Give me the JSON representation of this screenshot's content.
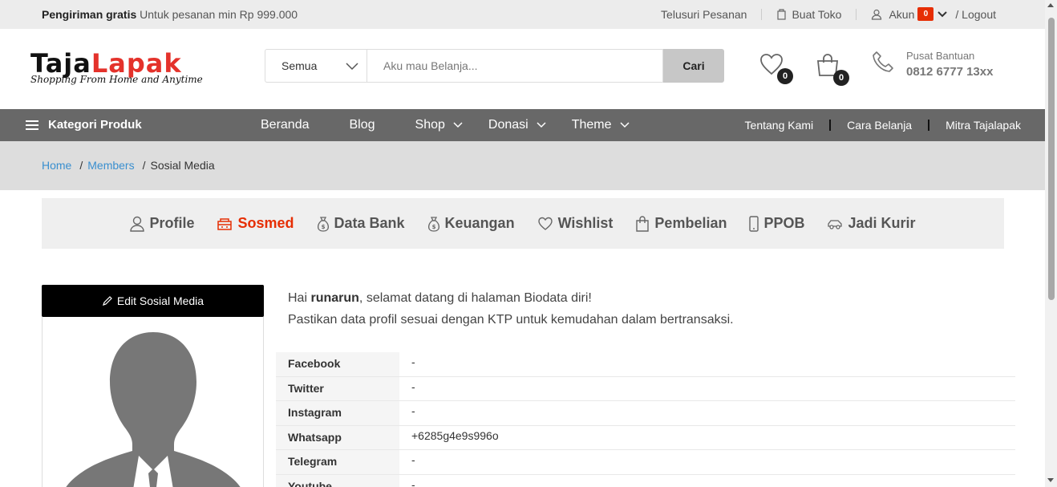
{
  "topbar": {
    "promo_bold": "Pengiriman gratis",
    "promo_text": "Untuk pesanan min Rp 999.000",
    "track_order": "Telusuri Pesanan",
    "open_store": "Buat Toko",
    "account": "Akun",
    "account_badge": "0",
    "logout": "/ Logout"
  },
  "header": {
    "logo_part1": "Taja",
    "logo_part2": "Lapak",
    "tagline": "Shopping From Home and Anytime",
    "search_category": "Semua",
    "search_placeholder": "Aku mau Belanja...",
    "search_button": "Cari",
    "wishlist_count": "0",
    "cart_count": "0",
    "help_label": "Pusat Bantuan",
    "help_phone": "0812 6777 13xx"
  },
  "nav": {
    "categories": "Kategori Produk",
    "items": [
      "Beranda",
      "Blog",
      "Shop",
      "Donasi",
      "Theme"
    ],
    "right_links": [
      "Tentang Kami",
      "Cara Belanja",
      "Mitra Tajalapak"
    ]
  },
  "breadcrumb": {
    "home": "Home",
    "members": "Members",
    "current": "Sosial Media"
  },
  "tabs": [
    {
      "label": "Profile",
      "icon": "user-icon"
    },
    {
      "label": "Sosmed",
      "icon": "sosmed-icon"
    },
    {
      "label": "Data Bank",
      "icon": "money-bag-icon"
    },
    {
      "label": "Keuangan",
      "icon": "money-bag-icon"
    },
    {
      "label": "Wishlist",
      "icon": "heart-icon"
    },
    {
      "label": "Pembelian",
      "icon": "shopping-bag-icon"
    },
    {
      "label": "PPOB",
      "icon": "phone-icon"
    },
    {
      "label": "Jadi Kurir",
      "icon": "car-icon"
    }
  ],
  "sidebar": {
    "edit_button": "Edit Sosial Media"
  },
  "greeting": {
    "prefix": "Hai",
    "username": "runarun",
    "suffix": ", selamat datang di halaman Biodata diri!",
    "line2": "Pastikan data profil sesuai dengan KTP untuk kemudahan dalam bertransaksi."
  },
  "social": [
    {
      "label": "Facebook",
      "value": "-"
    },
    {
      "label": "Twitter",
      "value": "-"
    },
    {
      "label": "Instagram",
      "value": "-"
    },
    {
      "label": "Whatsapp",
      "value": "+6285g4e9s996o"
    },
    {
      "label": "Telegram",
      "value": "-"
    },
    {
      "label": "Youtube",
      "value": "-"
    }
  ],
  "colors": {
    "accent": "#e62e04",
    "brand_red": "#e4322b",
    "nav_bg": "#686868",
    "link": "#3a8fcf"
  }
}
